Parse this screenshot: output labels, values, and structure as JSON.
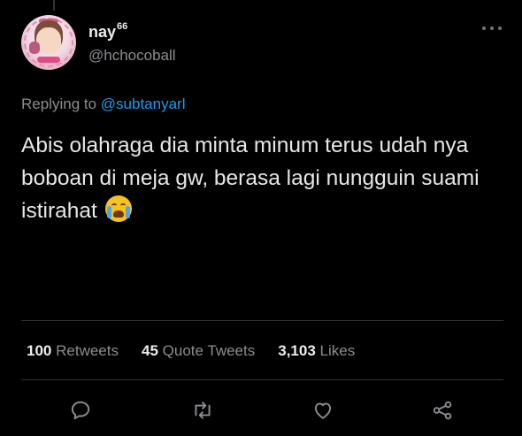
{
  "tweet": {
    "author": {
      "display_name": "nay",
      "display_name_sup": "66",
      "handle": "@hchocoball"
    },
    "reply_prefix": "Replying to",
    "reply_to": "@subtanyarl",
    "text": "Abis olahraga dia minta minum terus udah nya boboan di meja gw, berasa lagi nungguin suami istirahat",
    "emoji": "loudly-crying-face"
  },
  "stats": {
    "retweets_count": "100",
    "retweets_label": "Retweets",
    "quotes_count": "45",
    "quotes_label": "Quote Tweets",
    "likes_count": "3,103",
    "likes_label": "Likes"
  },
  "actions": [
    {
      "icon": "reply-icon"
    },
    {
      "icon": "retweet-icon"
    },
    {
      "icon": "like-icon"
    },
    {
      "icon": "share-icon"
    }
  ],
  "colors": {
    "background": "#000000",
    "link": "#1d9bf0",
    "muted": "#8a8d91",
    "divider": "#2f3336"
  }
}
